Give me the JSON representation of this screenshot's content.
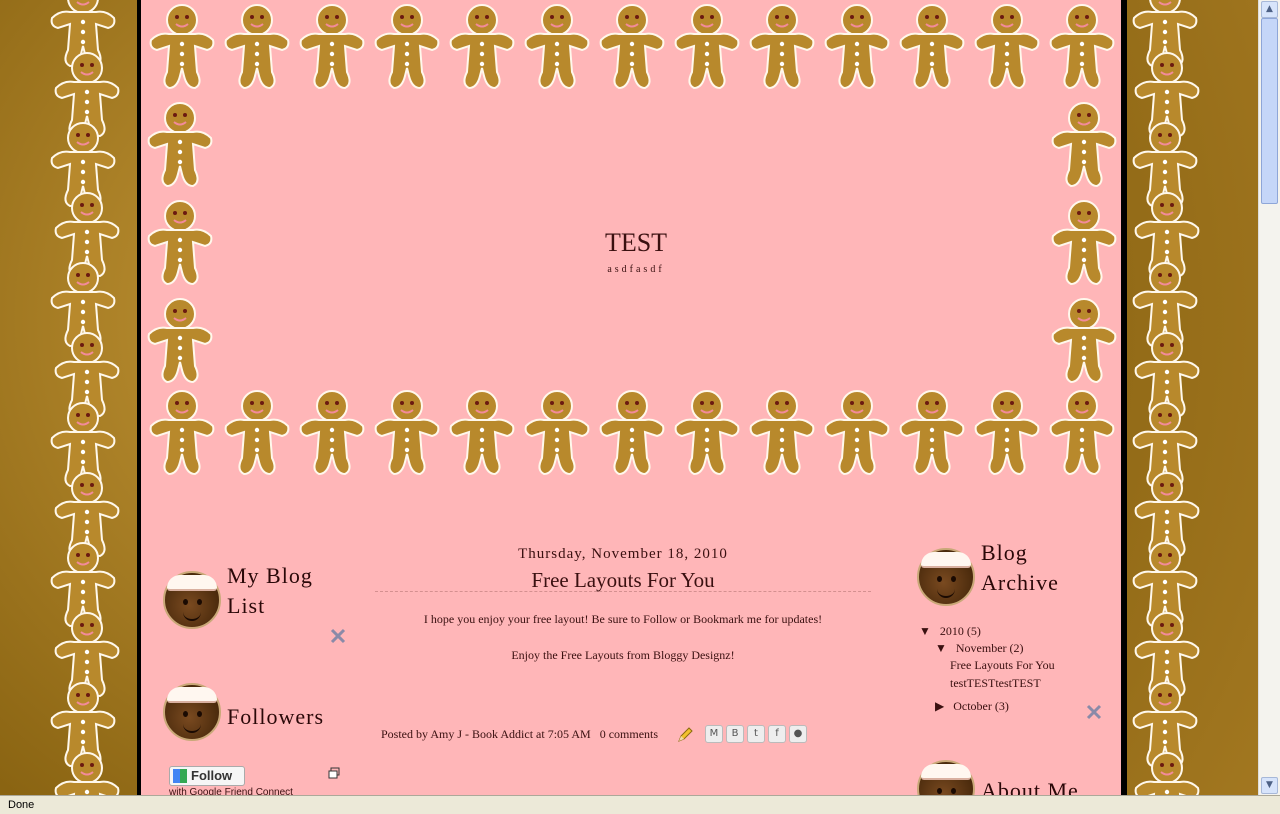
{
  "header": {
    "title": "TEST",
    "description": "asdfasdf"
  },
  "post": {
    "date": "Thursday, November 18, 2010",
    "title": "Free Layouts For You",
    "body1": "I hope you enjoy your free layout! Be sure to Follow or Bookmark me for updates!",
    "body2": "Enjoy the Free Layouts from Bloggy Designz!",
    "posted_by": "Posted by",
    "author": "Amy J - Book Addict",
    "at": "at",
    "time": "7:05 AM",
    "comments": "0 comments"
  },
  "sidebar_left": {
    "blog_list_title_1": "My Blog",
    "blog_list_title_2": "List",
    "followers_title": "Followers",
    "follow_button": "Follow",
    "follow_caption": "with Google Friend Connect"
  },
  "sidebar_right": {
    "archive_title_1": "Blog",
    "archive_title_2": "Archive",
    "year": "2010",
    "year_count": "(5)",
    "month1": "November",
    "month1_count": "(2)",
    "post1": "Free Layouts For You",
    "post2": "testTESTtestTEST",
    "month2": "October",
    "month2_count": "(3)",
    "about_title": "About Me"
  },
  "share_icons": [
    "email-icon",
    "blog-icon",
    "twitter-icon",
    "facebook-icon",
    "buzz-icon"
  ],
  "status": {
    "text": "Done"
  },
  "colors": {
    "background_pink": "#ffb6b8",
    "gingerbread": "#b8892c",
    "frame_black": "#000000"
  }
}
